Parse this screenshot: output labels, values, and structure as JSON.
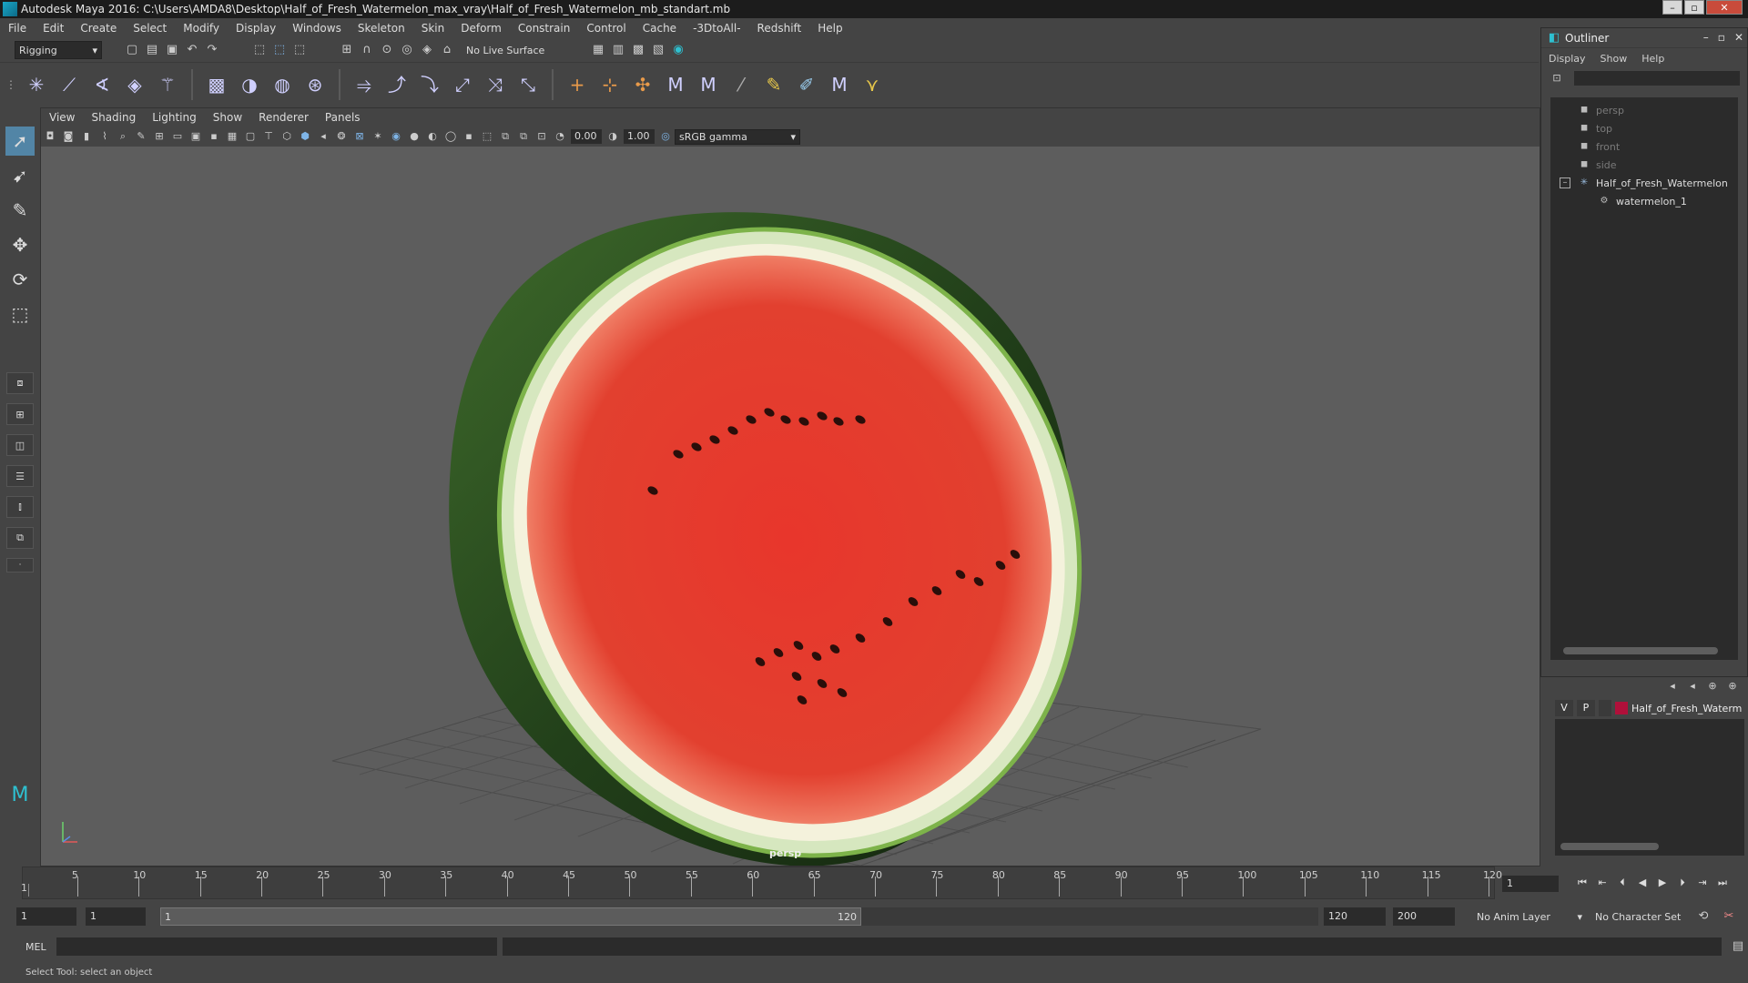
{
  "window": {
    "title": "Autodesk Maya 2016: C:\\Users\\AMDA8\\Desktop\\Half_of_Fresh_Watermelon_max_vray\\Half_of_Fresh_Watermelon_mb_standart.mb",
    "buttons": [
      "–",
      "▫",
      "✕"
    ]
  },
  "menubar": {
    "items": [
      "File",
      "Edit",
      "Create",
      "Select",
      "Modify",
      "Display",
      "Windows",
      "Skeleton",
      "Skin",
      "Deform",
      "Constrain",
      "Control",
      "Cache",
      "-3DtoAll-",
      "Redshift",
      "Help"
    ]
  },
  "statusline": {
    "mode": "Rigging",
    "live_surface": "No Live Surface"
  },
  "viewport": {
    "menu": [
      "View",
      "Shading",
      "Lighting",
      "Show",
      "Renderer",
      "Panels"
    ],
    "exposure": "0.00",
    "gamma_value": "1.00",
    "color_space": "sRGB gamma",
    "camera_label": "persp"
  },
  "outliner": {
    "title": "Outliner",
    "menu": [
      "Display",
      "Show",
      "Help"
    ],
    "items": [
      {
        "label": "persp",
        "icon": "camera-icon",
        "dim": true
      },
      {
        "label": "top",
        "icon": "camera-icon",
        "dim": true
      },
      {
        "label": "front",
        "icon": "camera-icon",
        "dim": true
      },
      {
        "label": "side",
        "icon": "camera-icon",
        "dim": true
      },
      {
        "label": "Half_of_Fresh_Watermelon",
        "icon": "joint-icon",
        "dim": false
      },
      {
        "label": "watermelon_1",
        "icon": "mesh-icon",
        "dim": false
      }
    ]
  },
  "layers": {
    "visible": "V",
    "playback": "P",
    "layer_name": "Half_of_Fresh_Waterm",
    "layer_color": "#b0103a"
  },
  "timeline": {
    "ticks": [
      "5",
      "10",
      "15",
      "20",
      "25",
      "30",
      "35",
      "40",
      "45",
      "50",
      "55",
      "60",
      "65",
      "70",
      "75",
      "80",
      "85",
      "90",
      "95",
      "100",
      "105",
      "110",
      "115",
      "120"
    ],
    "start_label": "1",
    "current_frame": "1"
  },
  "range": {
    "start": "1",
    "playback_start": "1",
    "thumb_start": "1",
    "thumb_end": "120",
    "playback_end": "120",
    "end": "200",
    "anim_layer": "No Anim Layer",
    "character_set": "No Character Set"
  },
  "commandline": {
    "mel_label": "MEL"
  },
  "helpline": {
    "text": "Select Tool: select an object"
  }
}
